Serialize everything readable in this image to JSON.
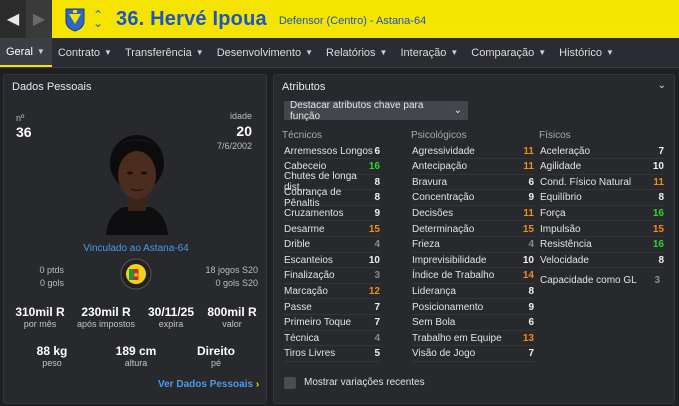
{
  "header": {
    "player_name": "36. Hervé Ipoua",
    "player_role": "Defensor (Centro) - Astana-64"
  },
  "tabs": [
    {
      "label": "Geral",
      "active": true
    },
    {
      "label": "Contrato"
    },
    {
      "label": "Transferência"
    },
    {
      "label": "Desenvolvimento"
    },
    {
      "label": "Relatórios"
    },
    {
      "label": "Interação"
    },
    {
      "label": "Comparação"
    },
    {
      "label": "Histórico"
    }
  ],
  "personal": {
    "title": "Dados Pessoais",
    "number_label": "nº",
    "number": "36",
    "age_label": "idade",
    "age": "20",
    "birth_date": "7/6/2002",
    "club_link": "Vinculado ao Astana-64",
    "points": "0 ptds",
    "goals": "0 gols",
    "games": "18 jogos S20",
    "games_goals": "0 gols S20",
    "stats": [
      {
        "value": "310mil R",
        "label": "por mês"
      },
      {
        "value": "230mil R",
        "label": "após impostos"
      },
      {
        "value": "30/11/25",
        "label": "expira"
      },
      {
        "value": "800mil R",
        "label": "valor"
      }
    ],
    "physical": [
      {
        "value": "88 kg",
        "label": "peso"
      },
      {
        "value": "189 cm",
        "label": "altura"
      },
      {
        "value": "Direito",
        "label": "pé"
      }
    ],
    "more_link": "Ver Dados Pessoais"
  },
  "attributes": {
    "title": "Atributos",
    "dropdown": "Destacar atributos chave para função",
    "technical_title": "Técnicos",
    "mental_title": "Psicológicos",
    "physical_title": "Físicos",
    "technical": [
      {
        "name": "Arremessos Longos",
        "value": "6",
        "color": "white"
      },
      {
        "name": "Cabeceio",
        "value": "16",
        "color": "green"
      },
      {
        "name": "Chutes de longa dist...",
        "value": "8",
        "color": "white"
      },
      {
        "name": "Cobrança de Pênaltis",
        "value": "8",
        "color": "white"
      },
      {
        "name": "Cruzamentos",
        "value": "9",
        "color": "white"
      },
      {
        "name": "Desarme",
        "value": "15",
        "color": "orange"
      },
      {
        "name": "Drible",
        "value": "4",
        "color": "grey"
      },
      {
        "name": "Escanteios",
        "value": "10",
        "color": "white"
      },
      {
        "name": "Finalização",
        "value": "3",
        "color": "grey"
      },
      {
        "name": "Marcação",
        "value": "12",
        "color": "orange"
      },
      {
        "name": "Passe",
        "value": "7",
        "color": "white"
      },
      {
        "name": "Primeiro Toque",
        "value": "7",
        "color": "white"
      },
      {
        "name": "Técnica",
        "value": "4",
        "color": "grey"
      },
      {
        "name": "Tiros Livres",
        "value": "5",
        "color": "white"
      }
    ],
    "mental": [
      {
        "name": "Agressividade",
        "value": "11",
        "color": "orange"
      },
      {
        "name": "Antecipação",
        "value": "11",
        "color": "orange"
      },
      {
        "name": "Bravura",
        "value": "6",
        "color": "white"
      },
      {
        "name": "Concentração",
        "value": "9",
        "color": "white"
      },
      {
        "name": "Decisões",
        "value": "11",
        "color": "orange"
      },
      {
        "name": "Determinação",
        "value": "15",
        "color": "orange"
      },
      {
        "name": "Frieza",
        "value": "4",
        "color": "grey"
      },
      {
        "name": "Imprevisibilidade",
        "value": "10",
        "color": "white"
      },
      {
        "name": "Índice de Trabalho",
        "value": "14",
        "color": "orange"
      },
      {
        "name": "Liderança",
        "value": "8",
        "color": "white"
      },
      {
        "name": "Posicionamento",
        "value": "9",
        "color": "white"
      },
      {
        "name": "Sem Bola",
        "value": "6",
        "color": "white"
      },
      {
        "name": "Trabalho em Equipe",
        "value": "13",
        "color": "orange"
      },
      {
        "name": "Visão de Jogo",
        "value": "7",
        "color": "white"
      }
    ],
    "physical": [
      {
        "name": "Aceleração",
        "value": "7",
        "color": "white"
      },
      {
        "name": "Agilidade",
        "value": "10",
        "color": "white"
      },
      {
        "name": "Cond. Físico Natural",
        "value": "11",
        "color": "orange"
      },
      {
        "name": "Equilíbrio",
        "value": "8",
        "color": "white"
      },
      {
        "name": "Força",
        "value": "16",
        "color": "green"
      },
      {
        "name": "Impulsão",
        "value": "15",
        "color": "orange"
      },
      {
        "name": "Resistência",
        "value": "16",
        "color": "green"
      },
      {
        "name": "Velocidade",
        "value": "8",
        "color": "white"
      }
    ],
    "gl_label": "Capacidade como GL",
    "gl_value": "3",
    "checkbox_label": "Mostrar variações recentes"
  },
  "colors": {
    "yellow": "#f5e300",
    "blue": "#1a57c4",
    "green": "#2fd52f",
    "orange": "#f08c1a"
  }
}
